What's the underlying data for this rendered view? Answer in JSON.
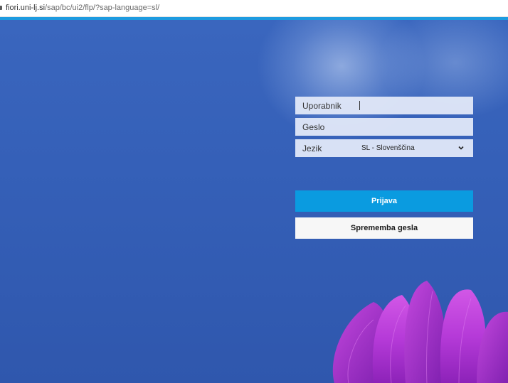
{
  "browser": {
    "url_host": "fiori.uni-lj.si",
    "url_path": "/sap/bc/ui2/flp/?sap-language=sl/"
  },
  "login": {
    "username_label": "Uporabnik",
    "username_value": "",
    "password_label": "Geslo",
    "password_value": "",
    "language_label": "Jezik",
    "language_selected": "SL - Slovenščina",
    "login_button": "Prijava",
    "change_password_button": "Sprememba gesla"
  },
  "colors": {
    "background": "#3560b8",
    "accent_bar": "#1e9be0",
    "login_button": "#0a9be0",
    "change_button": "#f7f7f7",
    "flower": "#b03ad6"
  },
  "icons": {
    "language_dropdown": "chevron-down-icon",
    "secure": "lock-icon"
  }
}
